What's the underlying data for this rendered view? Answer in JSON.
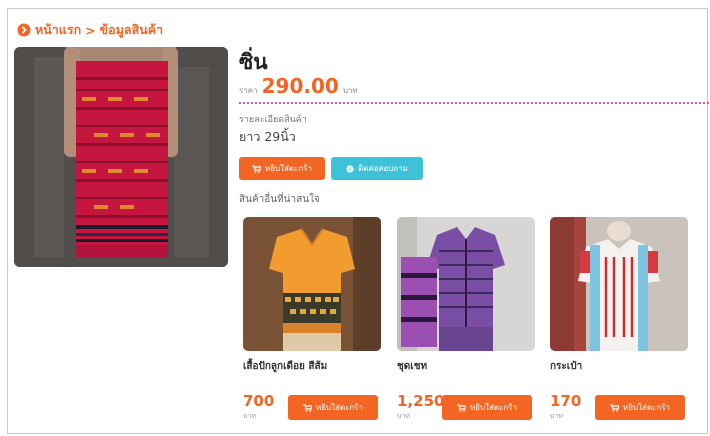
{
  "breadcrumb": {
    "home": "หน้าแรก",
    "separator": ">",
    "current": "ข้อมูลสินค้า"
  },
  "product": {
    "title": "ซิ่น",
    "price_label": "ราคา",
    "price_value": "290.00",
    "price_unit": "บาท",
    "detail_label": "รายละเอียดสินค้า",
    "detail_value": "ยาว 29นิ้ว",
    "cart_button": "หยิบใส่ตะกร้า",
    "contact_button": "ติดต่อสอบถาม"
  },
  "related": {
    "heading": "สินค้าอื่นที่น่าสนใจ",
    "items": [
      {
        "name": "เสื้อปักลูกเดือย สีส้ม",
        "price": "700",
        "unit": "บาท",
        "button": "หยิบใส่ตะกร้า"
      },
      {
        "name": "ชุดเชท",
        "price": "1,250",
        "unit": "บาท",
        "button": "หยิบใส่ตะกร้า"
      },
      {
        "name": "กระเป๋า",
        "price": "170",
        "unit": "บาท",
        "button": "หยิบใส่ตะกร้า"
      }
    ]
  },
  "colors": {
    "accent": "#f26522",
    "teal": "#3ec2d9",
    "divider": "#e052a8"
  }
}
